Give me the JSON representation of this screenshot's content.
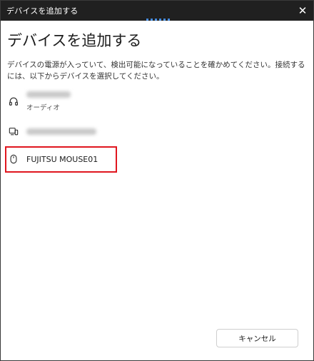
{
  "window": {
    "title": "デバイスを追加する",
    "close_glyph": "✕"
  },
  "main": {
    "heading": "デバイスを追加する",
    "description": "デバイスの電源が入っていて、検出可能になっていることを確かめてください。接続するには、以下からデバイスを選択してください。"
  },
  "devices": [
    {
      "icon": "headphones-icon",
      "name_obscured": true,
      "subtitle": "オーディオ"
    },
    {
      "icon": "devices-icon",
      "name_obscured": true
    },
    {
      "icon": "mouse-icon",
      "name": "FUJITSU MOUSE01",
      "highlighted": true
    }
  ],
  "footer": {
    "cancel_label": "キャンセル"
  },
  "colors": {
    "titlebar": "#202020",
    "highlight": "#e0161f",
    "progress": "#4a90e2"
  }
}
